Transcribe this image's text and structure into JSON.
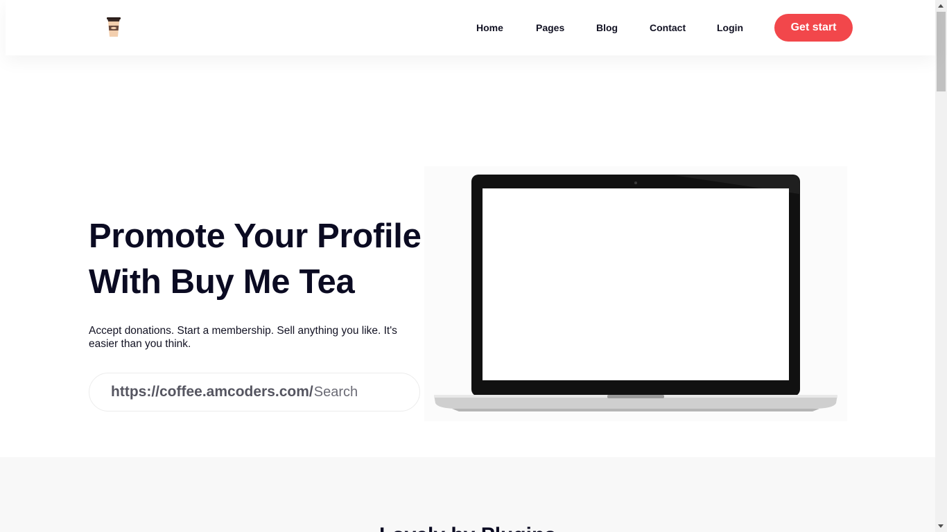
{
  "header": {
    "logo_icon": "coffee-cup-icon",
    "nav": [
      {
        "label": "Home"
      },
      {
        "label": "Pages"
      },
      {
        "label": "Blog"
      },
      {
        "label": "Contact"
      },
      {
        "label": "Login"
      }
    ],
    "cta_label": "Get start"
  },
  "hero": {
    "title_line1": "Promote Your Profile",
    "title_line2": "With Buy Me Tea",
    "subtitle": "Accept donations. Start a membership. Sell anything you like. It's easier than you think.",
    "url_prefix": "https://coffee.amcoders.com/",
    "search_placeholder": "Search",
    "image_icon": "laptop-illustration"
  },
  "section2": {
    "title": "Lovely by Plugins"
  },
  "colors": {
    "accent": "#f2474b",
    "heading": "#0b0b22",
    "section_bg": "#f8f8f8"
  }
}
